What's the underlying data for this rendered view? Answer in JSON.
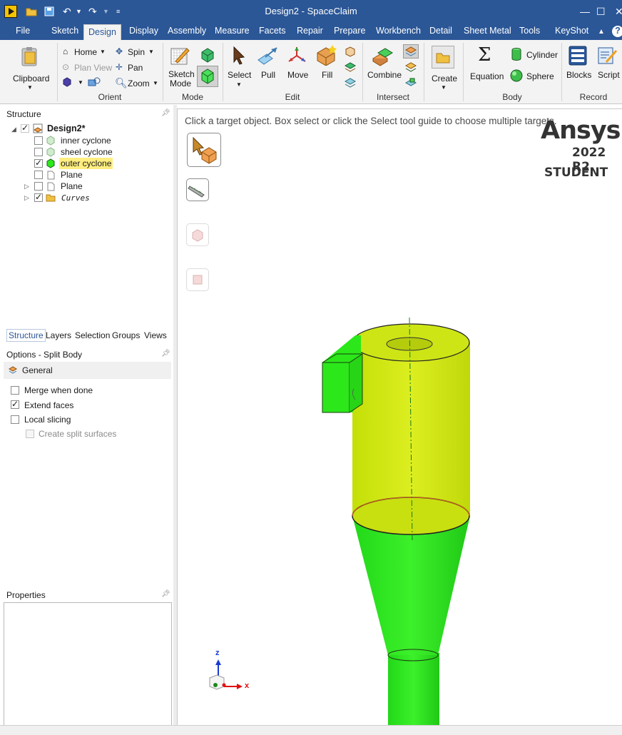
{
  "window": {
    "title": "Design2 - SpaceClaim"
  },
  "tabs": [
    "File",
    "Sketch",
    "Design",
    "Display",
    "Assembly",
    "Measure",
    "Facets",
    "Repair",
    "Prepare",
    "Workbench",
    "Detail",
    "Sheet Metal",
    "Tools",
    "KeyShot"
  ],
  "active_tab": "Design",
  "ribbon": {
    "clipboard": {
      "button": "Clipboard"
    },
    "orient": {
      "label": "Orient",
      "home": "Home",
      "plan_view": "Plan View",
      "spin": "Spin",
      "pan": "Pan",
      "zoom": "Zoom"
    },
    "mode": {
      "label": "Mode",
      "sketch_mode": "Sketch Mode"
    },
    "edit": {
      "label": "Edit",
      "select": "Select",
      "pull": "Pull",
      "move": "Move",
      "fill": "Fill"
    },
    "intersect": {
      "label": "Intersect",
      "combine": "Combine"
    },
    "create": {
      "create": "Create"
    },
    "body": {
      "label": "Body",
      "equation": "Equation",
      "cylinder": "Cylinder",
      "sphere": "Sphere"
    },
    "record": {
      "label": "Record",
      "blocks": "Blocks",
      "script": "Script"
    }
  },
  "structure": {
    "title": "Structure",
    "root": "Design2*",
    "items": [
      {
        "label": "inner cyclone",
        "checked": false,
        "icon": "body-icon"
      },
      {
        "label": "sheel cyclone",
        "checked": false,
        "icon": "body-icon"
      },
      {
        "label": "outer cyclone",
        "checked": true,
        "icon": "body-icon",
        "highlighted": true
      },
      {
        "label": "Plane",
        "checked": false,
        "icon": "plane-icon"
      },
      {
        "label": "Plane",
        "checked": false,
        "icon": "plane-icon"
      },
      {
        "label": "Curves",
        "checked": true,
        "icon": "folder-icon"
      }
    ]
  },
  "panel_tabs": [
    "Structure",
    "Layers",
    "Selection",
    "Groups",
    "Views"
  ],
  "options": {
    "title": "Options - Split Body",
    "section": "General",
    "items": [
      {
        "label": "Merge when done",
        "checked": false
      },
      {
        "label": "Extend faces",
        "checked": true
      },
      {
        "label": "Local slicing",
        "checked": false
      },
      {
        "label": "Create split surfaces",
        "checked": false,
        "disabled": true
      }
    ]
  },
  "properties": {
    "title": "Properties"
  },
  "viewport": {
    "hint": "Click a target object.  Box select or click the Select tool guide to choose multiple targets.",
    "brand_name": "Ansys",
    "brand_version": "2022 R2",
    "brand_edition": "STUDENT",
    "triad_z": "z",
    "triad_x": "x"
  },
  "colors": {
    "titlebar": "#2b5797",
    "body_green": "#2ce81a",
    "body_yellow": "#cbe30c",
    "highlight": "#ffee80"
  }
}
